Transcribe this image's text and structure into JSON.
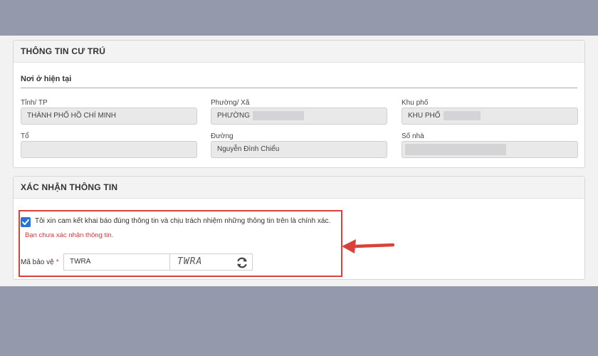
{
  "residence": {
    "section_title": "THÔNG TIN CƯ TRÚ",
    "subsection_title": "Nơi ở hiện tại",
    "fields": [
      {
        "label": "Tỉnh/ TP",
        "value": "THÀNH PHỐ HỒ CHÍ MINH"
      },
      {
        "label": "Phường/ Xã",
        "value": "PHƯỜNG"
      },
      {
        "label": "Khu phố",
        "value": "KHU PHỐ"
      },
      {
        "label": "Tổ",
        "value": ""
      },
      {
        "label": "Đường",
        "value": "Nguyễn Đình Chiểu"
      },
      {
        "label": "Số nhà",
        "value": ""
      }
    ]
  },
  "confirm": {
    "section_title": "XÁC NHẬN THÔNG TIN",
    "commitment_text": "Tôi xin cam kết khai báo đúng thông tin và chịu trách nhiệm những thông tin trên là chính xác.",
    "commitment_checked": true,
    "warning_text": "Bạn chưa xác nhận thông tin.",
    "captcha_label": "Mã bảo vệ",
    "captcha_required_mark": "*",
    "captcha_input_value": "TWRA",
    "captcha_image_text": "TWRA",
    "refresh_icon": "refresh-icon"
  },
  "colors": {
    "background": "#949aac",
    "highlight_border": "#d9423b",
    "warning": "#d9363e",
    "checkbox": "#2a73d8"
  }
}
